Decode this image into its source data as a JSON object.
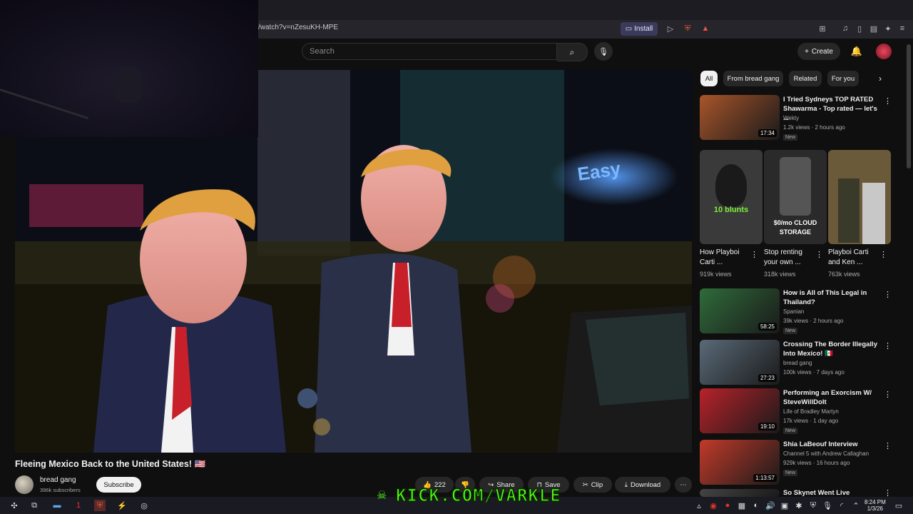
{
  "browser": {
    "url": "/watch?v=nZesuKH-MPE",
    "install_label": "Install"
  },
  "header": {
    "search_placeholder": "Search",
    "create_label": "Create"
  },
  "video": {
    "title": "Fleeing Mexico Back to the United States! 🇺🇸",
    "channel_name": "bread gang",
    "channel_subs": "396k subscribers",
    "subscribe_label": "Subscribe",
    "like_count": "222",
    "share_label": "Share",
    "save_label": "Save",
    "clip_label": "Clip",
    "download_label": "Download",
    "overlay_text": "KICK.COM/VARKLE"
  },
  "sidebar": {
    "chips": [
      "All",
      "From bread gang",
      "Related",
      "For you"
    ],
    "recs": [
      {
        "title": "I Tried Sydneys TOP RATED Shawarma - Top rated — let's ...",
        "channel": "Wekty",
        "meta": "1.2k views · 2 hours ago",
        "new": "New",
        "duration": "17:34",
        "color": "#a8552a"
      },
      {
        "title": "How is All of This Legal in Thailand?",
        "channel": "Spanian",
        "meta": "39k views · 2 hours ago",
        "new": "New",
        "duration": "58:25",
        "color": "#2f6b3a"
      },
      {
        "title": "Crossing The Border Illegally Into Mexico! 🇲🇽",
        "channel": "bread gang",
        "meta": "100k views · 7 days ago",
        "new": "",
        "duration": "27:23",
        "color": "#5a6a78"
      },
      {
        "title": "Performing an Exorcism W/ SteveWillDoIt",
        "channel": "Life of Bradley Martyn",
        "meta": "17k views · 1 day ago",
        "new": "New",
        "duration": "19:10",
        "color": "#b8222a"
      },
      {
        "title": "Shia LaBeouf Interview",
        "channel": "Channel 5 with Andrew Callaghan",
        "meta": "929k views · 16 hours ago",
        "new": "New",
        "duration": "1:13:57",
        "color": "#c23a2a"
      },
      {
        "title": "So Skynet Went Live",
        "channel": "",
        "meta": "",
        "new": "",
        "duration": "",
        "color": "#444"
      }
    ],
    "shorts": [
      {
        "title": "How Playboi Carti ...",
        "views": "919k views",
        "caption": "10 blunts",
        "color": "#3a3a3a"
      },
      {
        "title": "Stop renting your own ...",
        "views": "318k views",
        "caption": "$0/mo CLOUD STORAGE",
        "color": "#2a2a2a"
      },
      {
        "title": "Playboi Carti and Ken ...",
        "views": "763k views",
        "caption": "",
        "color": "#6a5a3a"
      }
    ]
  },
  "taskbar": {
    "time": "8:24 PM",
    "date": "1/3/26"
  }
}
